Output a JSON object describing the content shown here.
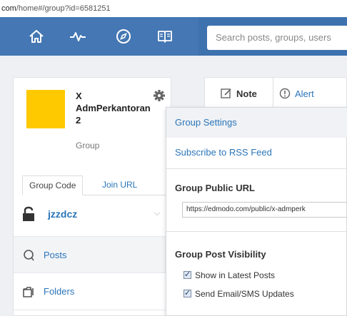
{
  "address_bar": {
    "domain": "com",
    "path": "/home#/group?id=6581251"
  },
  "navbar": {
    "icons": [
      "home-icon",
      "activity-icon",
      "compass-icon",
      "book-icon"
    ],
    "search_placeholder": "Search posts, groups, users"
  },
  "group": {
    "name": "X AdmPerkantoran 2",
    "type": "Group",
    "avatar_color": "#ffc900",
    "tabs": [
      {
        "label": "Group Code"
      },
      {
        "label": "Join URL"
      }
    ],
    "code": "jzzdcz"
  },
  "sidebar": {
    "items": [
      {
        "label": "Posts"
      },
      {
        "label": "Folders"
      }
    ]
  },
  "composer": {
    "tabs": [
      {
        "label": "Note"
      },
      {
        "label": "Alert"
      }
    ]
  },
  "settings_menu": {
    "items": [
      {
        "label": "Group Settings"
      },
      {
        "label": "Subscribe to RSS Feed"
      }
    ],
    "public_url_heading": "Group Public URL",
    "public_url": "https://edmodo.com/public/x-admperk",
    "visibility_heading": "Group Post Visibility",
    "checkboxes": [
      {
        "label": "Show in Latest Posts",
        "checked": true
      },
      {
        "label": "Send Email/SMS Updates",
        "checked": true
      }
    ]
  },
  "colors": {
    "navbar": "#3e72ae",
    "link": "#2b75b8"
  }
}
